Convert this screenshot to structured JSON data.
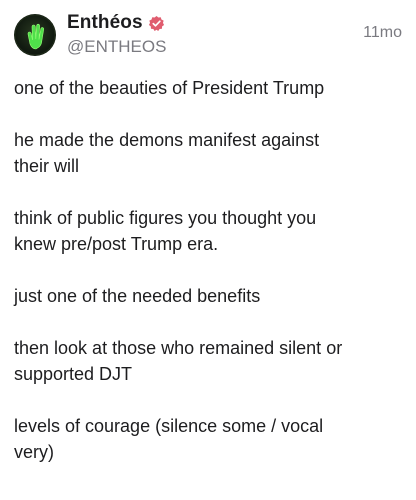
{
  "post": {
    "author": {
      "display_name": "Enthéos",
      "handle": "@ENTHEOS",
      "verified": true,
      "avatar_icon": "green-hand-avatar-icon",
      "verified_icon": "verified-badge-icon",
      "verified_color": "#e05d6f"
    },
    "timestamp": "11mo",
    "paragraphs": [
      "one of the beauties of President Trump",
      "he made the demons manifest against\ntheir will",
      "think of public figures you thought you\nknew pre/post Trump era.",
      "just one of the needed benefits",
      "then look at those who remained silent or\nsupported DJT",
      "levels of courage (silence some / vocal\nvery)"
    ]
  }
}
